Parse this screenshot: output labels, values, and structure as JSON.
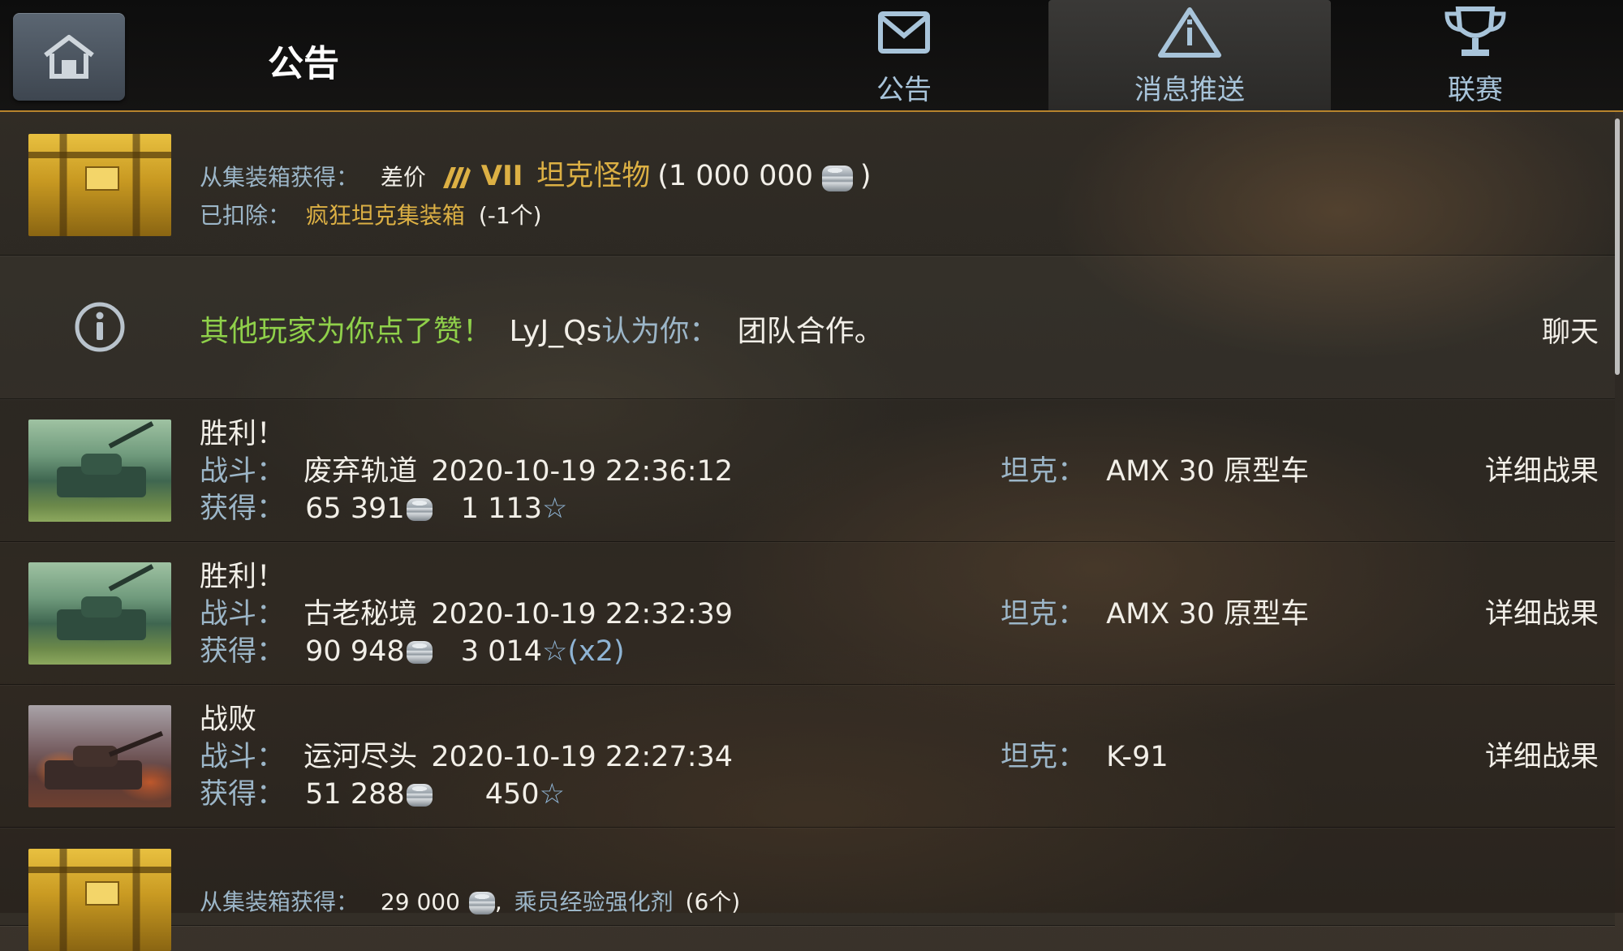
{
  "header": {
    "title": "公告",
    "tabs": [
      {
        "label": "公告",
        "icon": "envelope-icon"
      },
      {
        "label": "消息推送",
        "icon": "warning-triangle-icon"
      },
      {
        "label": "联赛",
        "icon": "trophy-icon"
      }
    ],
    "active_tab": "消息推送"
  },
  "rows": {
    "box1": {
      "obtained_label": "从集装箱获得：",
      "price_diff": "差价",
      "tier": "VII",
      "tank_name": "坦克怪物",
      "open_paren": "(",
      "amount": "1 000 000",
      "close_paren": ")",
      "deducted_label": "已扣除：",
      "container_name": "疯狂坦克集装箱",
      "deducted_count": "(-1个)"
    },
    "info": {
      "praise": "其他玩家为你点了赞！",
      "player": "LyJ_Qs",
      "thinks": "认为你：",
      "trait": "团队合作。",
      "chat": "聊天"
    },
    "battles": [
      {
        "result": "胜利！",
        "battle_label": "战斗：",
        "map": "废弃轨道",
        "datetime": "2020-10-19 22:36:12",
        "earned_label": "获得：",
        "credits": "65 391",
        "xp": "1 113",
        "multiplier": "",
        "tank_label": "坦克：",
        "tank": "AMX 30 原型车",
        "details": "详细战果"
      },
      {
        "result": "胜利！",
        "battle_label": "战斗：",
        "map": "古老秘境",
        "datetime": "2020-10-19 22:32:39",
        "earned_label": "获得：",
        "credits": "90 948",
        "xp": "3 014",
        "multiplier": "(x2)",
        "tank_label": "坦克：",
        "tank": "AMX 30 原型车",
        "details": "详细战果"
      },
      {
        "result": "战败",
        "battle_label": "战斗：",
        "map": "运河尽头",
        "datetime": "2020-10-19 22:27:34",
        "earned_label": "获得：",
        "credits": "51 288",
        "xp": "450",
        "multiplier": "",
        "tank_label": "坦克：",
        "tank": "K-91",
        "details": "详细战果"
      }
    ],
    "box2": {
      "obtained_label": "从集装箱获得：",
      "credits": "29 000",
      "comma": ",",
      "item": "乘员经验强化剂",
      "count": "(6个)"
    }
  },
  "icons": {
    "home": "home-icon",
    "info": "info-icon",
    "credit": "silver-coin-icon",
    "xp": "star-icon",
    "tier_badge": "tier-badge-icon"
  },
  "colors": {
    "accent_gold": "#dcb044",
    "praise_green": "#8fd04a",
    "label_blue": "#9cb6c8",
    "header_border": "#b7842d"
  }
}
